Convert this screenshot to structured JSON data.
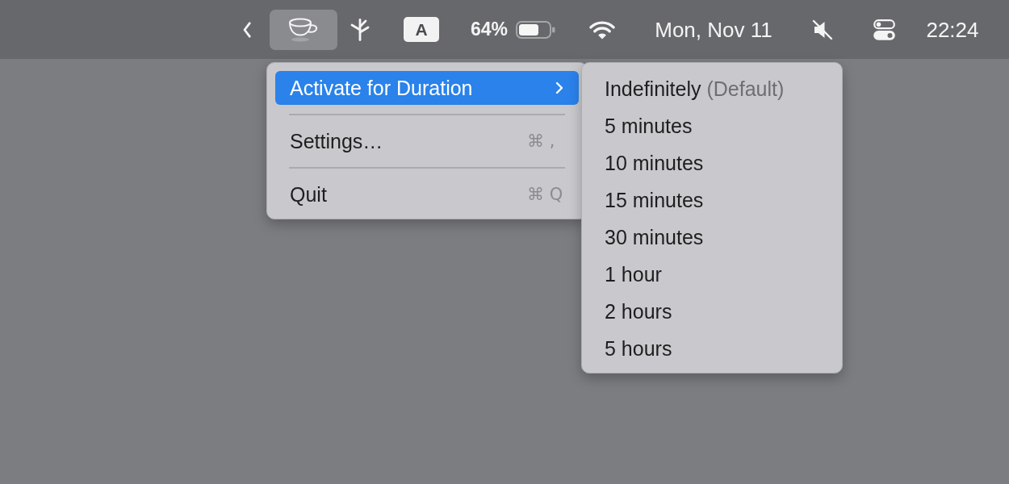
{
  "menu_bar": {
    "items": [
      {
        "kind": "chevron",
        "selected": false
      },
      {
        "kind": "cup",
        "selected": true
      },
      {
        "kind": "branch",
        "selected": false
      },
      {
        "kind": "input",
        "label": "A",
        "selected": false
      },
      {
        "kind": "battery",
        "label": "64%",
        "selected": false
      },
      {
        "kind": "wifi",
        "selected": false
      },
      {
        "kind": "date",
        "label": "Mon, Nov 11",
        "selected": false
      },
      {
        "kind": "mute",
        "selected": false
      },
      {
        "kind": "controls",
        "selected": false
      },
      {
        "kind": "clock",
        "label": "22:24",
        "selected": false
      }
    ]
  },
  "menu": {
    "items": [
      {
        "kind": "submenu",
        "label": "Activate for Duration",
        "selected": true
      },
      {
        "kind": "item",
        "label": "Settings…",
        "shortcut": "⌘ ,",
        "selected": false
      },
      {
        "kind": "item",
        "label": "Quit",
        "shortcut": "⌘ Q",
        "selected": false
      }
    ]
  },
  "submenu": {
    "items": [
      {
        "label": "Indefinitely",
        "note": "(Default)",
        "selected": false
      },
      {
        "label": "5 minutes",
        "selected": false
      },
      {
        "label": "10 minutes",
        "selected": false
      },
      {
        "label": "15 minutes",
        "selected": false
      },
      {
        "label": "30 minutes",
        "selected": false
      },
      {
        "label": "1 hour",
        "selected": false
      },
      {
        "label": "2 hours",
        "selected": false
      },
      {
        "label": "5 hours",
        "selected": false
      }
    ]
  }
}
